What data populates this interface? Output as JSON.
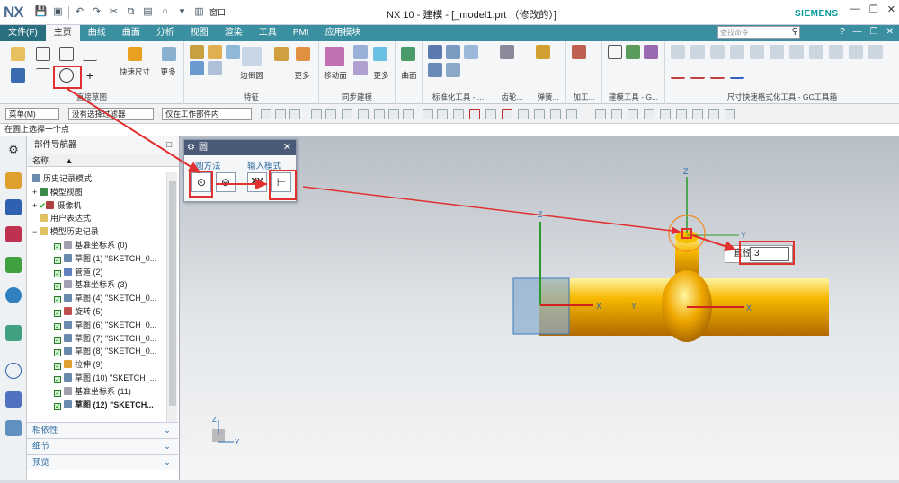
{
  "app": {
    "logo": "NX",
    "title": "NX 10 - 建模 - [_model1.prt （修改的）]",
    "brand": "SIEMENS",
    "window_menu": "窗口"
  },
  "tabs": [
    {
      "label": "文件(F)"
    },
    {
      "label": "主页"
    },
    {
      "label": "曲线"
    },
    {
      "label": "曲面"
    },
    {
      "label": "分析"
    },
    {
      "label": "视图"
    },
    {
      "label": "渲染"
    },
    {
      "label": "工具"
    },
    {
      "label": "PMI"
    },
    {
      "label": "应用模块"
    }
  ],
  "search": {
    "placeholder": "查找命令"
  },
  "ribbon": {
    "groups": [
      {
        "label": "直接草图"
      },
      {
        "label": "特征"
      },
      {
        "label": "同步建模"
      },
      {
        "label": "标准化工具 - ..."
      },
      {
        "label": "齿轮..."
      },
      {
        "label": "弹簧..."
      },
      {
        "label": "加工..."
      },
      {
        "label": "建模工具 - G..."
      },
      {
        "label": "尺寸快速格式化工具 - GC工具箱"
      }
    ],
    "buttons": {
      "quick_dim": "快速尺寸",
      "more1": "更多",
      "edge_blend": "边倒圆",
      "more2": "更多",
      "move_face": "移动面",
      "more3": "更多",
      "surface": "曲面",
      "more4": "更多"
    }
  },
  "selbar": {
    "menu": "菜单(M)",
    "filter": "没有选择过滤器",
    "scope": "仅在工作部件内"
  },
  "prompt": "在圆上选择一个点",
  "navigator": {
    "title": "部件导航器",
    "col": "名称",
    "items": [
      {
        "label": "历史记录模式"
      },
      {
        "label": "模型视图"
      },
      {
        "label": "摄像机"
      },
      {
        "label": "用户表达式"
      },
      {
        "label": "模型历史记录"
      },
      {
        "label": "基准坐标系 (0)"
      },
      {
        "label": "草图 (1) \"SKETCH_0..."
      },
      {
        "label": "管道 (2)"
      },
      {
        "label": "基准坐标系 (3)"
      },
      {
        "label": "草图 (4) \"SKETCH_0..."
      },
      {
        "label": "旋转 (5)"
      },
      {
        "label": "草图 (6) \"SKETCH_0..."
      },
      {
        "label": "草图 (7) \"SKETCH_0..."
      },
      {
        "label": "草图 (8) \"SKETCH_0..."
      },
      {
        "label": "拉伸 (9)"
      },
      {
        "label": "草图 (10) \"SKETCH_..."
      },
      {
        "label": "基准坐标系 (11)"
      },
      {
        "label": "草图 (12) \"SKETCH..."
      }
    ],
    "panels": [
      {
        "label": "相依性"
      },
      {
        "label": "细节"
      },
      {
        "label": "预览"
      }
    ]
  },
  "dialog": {
    "title": "圆",
    "section1": "圆方法",
    "section2": "输入模式",
    "xy_label": "XY"
  },
  "dim_input": {
    "label": "直径",
    "value": "3"
  },
  "axes": {
    "x": "X",
    "y": "Y",
    "z": "Z"
  },
  "colors": {
    "ribbon_tab": "#3a8fa0",
    "pipe": "#f0a000",
    "accent_red": "#e03030"
  }
}
